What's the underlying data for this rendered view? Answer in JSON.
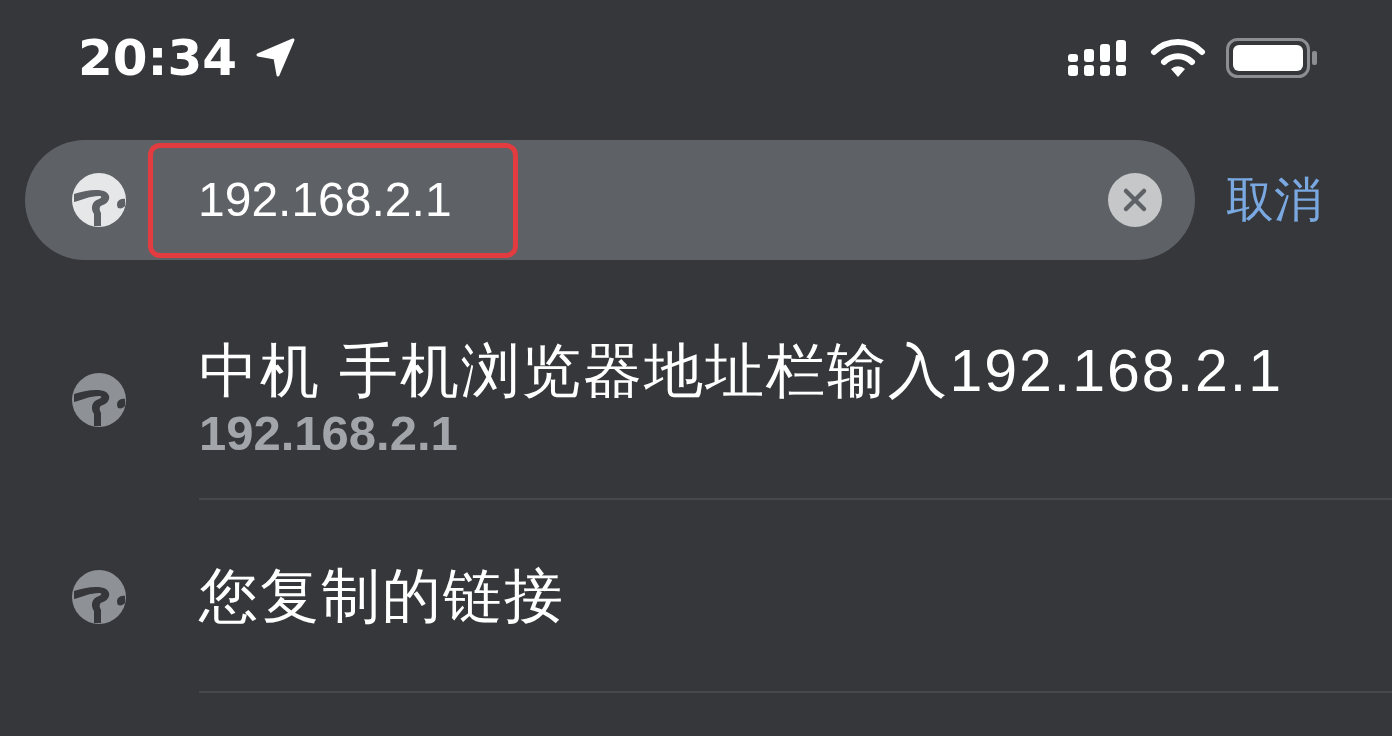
{
  "status_bar": {
    "time": "20:34"
  },
  "address_bar": {
    "value": "192.168.2.1",
    "highlighted": true,
    "cancel": "取消"
  },
  "suggestions": [
    {
      "title": "中机 手机浏览器地址栏输入192.168.2.1",
      "url": "192.168.2.1"
    },
    {
      "title": "您复制的链接"
    }
  ]
}
